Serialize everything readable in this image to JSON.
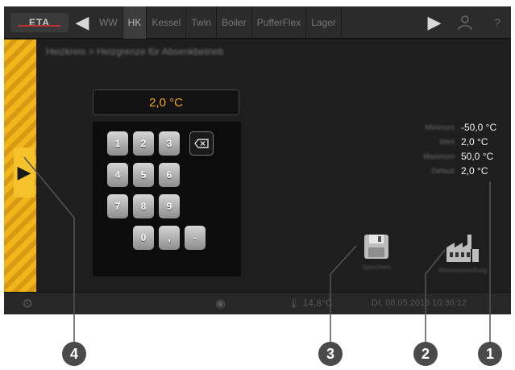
{
  "topbar": {
    "logo": "ETA",
    "tabs": [
      {
        "label": "WW",
        "active": false
      },
      {
        "label": "HK",
        "active": true
      },
      {
        "label": "Kessel",
        "active": false
      },
      {
        "label": "Twin",
        "active": false
      },
      {
        "label": "Boiler",
        "active": false
      },
      {
        "label": "PufferFlex",
        "active": false
      },
      {
        "label": "Lager",
        "active": false
      }
    ],
    "icons": [
      "arrow-left-icon",
      "arrow-right-icon",
      "user-icon",
      "help-icon"
    ]
  },
  "main": {
    "title": "Heizkreis > Heizgrenze für Absenkbetrieb"
  },
  "keypad": {
    "display_value": "2,0 °C",
    "keys": [
      "1",
      "2",
      "3",
      "4",
      "5",
      "6",
      "7",
      "8",
      "9",
      "0",
      ",",
      "-"
    ],
    "backspace_icon": "backspace-icon"
  },
  "limits": [
    {
      "label": "Minimum",
      "value": "-50,0 °C"
    },
    {
      "label": "Wert",
      "value": "2,0 °C"
    },
    {
      "label": "Maximum",
      "value": "50,0 °C"
    },
    {
      "label": "Default",
      "value": "2,0 °C"
    }
  ],
  "actions": {
    "save_label": "Speichern",
    "factory_label": "Werkseinstellung"
  },
  "statusbar": {
    "temperature": "14,8°C",
    "datetime": "DI, 08.05.2016 10:36:12"
  },
  "callouts": [
    "1",
    "2",
    "3",
    "4"
  ],
  "colors": {
    "accent": "#f2a51c",
    "hatch": "#f2b61a",
    "screen_bg": "#1e1e1e"
  }
}
